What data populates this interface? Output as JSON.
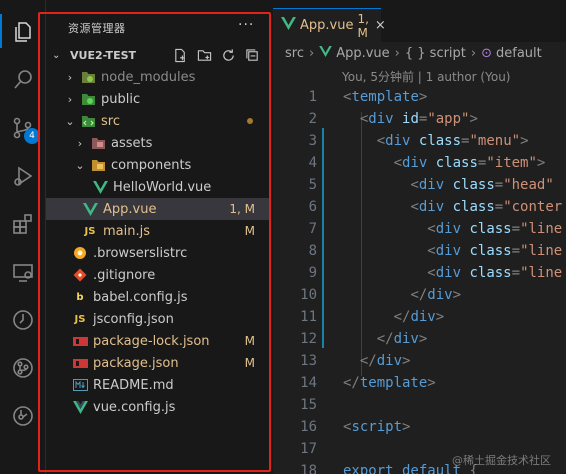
{
  "explorer": {
    "title": "资源管理器",
    "more": "···",
    "project": "VUE2-TEST",
    "actions": [
      "new-file-icon",
      "new-folder-icon",
      "refresh-icon",
      "collapse-all-icon"
    ]
  },
  "activity_bar": {
    "icons": [
      "explorer-icon",
      "search-icon",
      "source-control-icon",
      "run-debug-icon",
      "extensions-icon",
      "remote-explorer-icon",
      "timeline-icon",
      "git-graph-icon",
      "docker-icon"
    ],
    "source_control_badge": "4"
  },
  "tree": [
    {
      "name": "node_modules",
      "icon": "folder-node-icon",
      "status": "",
      "style": "dim"
    },
    {
      "name": "public",
      "icon": "folder-public-icon",
      "status": "",
      "style": "normal"
    },
    {
      "name": "src",
      "icon": "folder-src-icon",
      "status": "",
      "style": "orange"
    },
    {
      "name": "assets",
      "icon": "folder-assets-icon",
      "status": "",
      "style": "normal"
    },
    {
      "name": "components",
      "icon": "folder-components-icon",
      "status": "",
      "style": "normal"
    },
    {
      "name": "HelloWorld.vue",
      "icon": "vue-file-icon",
      "status": "",
      "style": "normal"
    },
    {
      "name": "App.vue",
      "icon": "vue-file-icon",
      "status": "1, M",
      "style": "orange"
    },
    {
      "name": "main.js",
      "icon": "js-file-icon",
      "status": "M",
      "style": "orange"
    },
    {
      "name": ".browserslistrc",
      "icon": "browserslist-icon",
      "status": "",
      "style": "normal"
    },
    {
      "name": ".gitignore",
      "icon": "git-file-icon",
      "status": "",
      "style": "normal"
    },
    {
      "name": "babel.config.js",
      "icon": "babel-icon",
      "status": "",
      "style": "normal"
    },
    {
      "name": "jsconfig.json",
      "icon": "js-file-icon",
      "status": "",
      "style": "normal"
    },
    {
      "name": "package-lock.json",
      "icon": "npm-icon",
      "status": "M",
      "style": "orange"
    },
    {
      "name": "package.json",
      "icon": "npm-icon",
      "status": "M",
      "style": "orange"
    },
    {
      "name": "README.md",
      "icon": "markdown-icon",
      "status": "",
      "style": "normal"
    },
    {
      "name": "vue.config.js",
      "icon": "vue-config-icon",
      "status": "",
      "style": "normal"
    }
  ],
  "tab": {
    "label": "App.vue",
    "status": "1, M",
    "close": "×"
  },
  "breadcrumb": [
    "src",
    "App.vue",
    "{ } script",
    "default"
  ],
  "blame": "You, 5分钟前 | 1 author (You)",
  "code_lines": [
    {
      "n": "1",
      "text": "<template>"
    },
    {
      "n": "2",
      "text": "  <div id=\"app\">"
    },
    {
      "n": "3",
      "text": "    <div class=\"menu\">"
    },
    {
      "n": "4",
      "text": "      <div class=\"item\">"
    },
    {
      "n": "5",
      "text": "        <div class=\"head\""
    },
    {
      "n": "6",
      "text": "        <div class=\"conter"
    },
    {
      "n": "7",
      "text": "          <div class=\"line"
    },
    {
      "n": "8",
      "text": "          <div class=\"line"
    },
    {
      "n": "9",
      "text": "          <div class=\"line"
    },
    {
      "n": "10",
      "text": "        </div>"
    },
    {
      "n": "11",
      "text": "      </div>"
    },
    {
      "n": "12",
      "text": "    </div>"
    },
    {
      "n": "13",
      "text": "  </div>"
    },
    {
      "n": "14",
      "text": "</template>"
    },
    {
      "n": "15",
      "text": ""
    },
    {
      "n": "16",
      "text": "<script>"
    },
    {
      "n": "17",
      "text": ""
    },
    {
      "n": "18",
      "text": "export default {"
    }
  ],
  "watermark": "@稀土掘金技术社区",
  "colors": {
    "accent": "#0078d4",
    "modified": "#e2c08d",
    "highlight_border": "#e2231a"
  }
}
